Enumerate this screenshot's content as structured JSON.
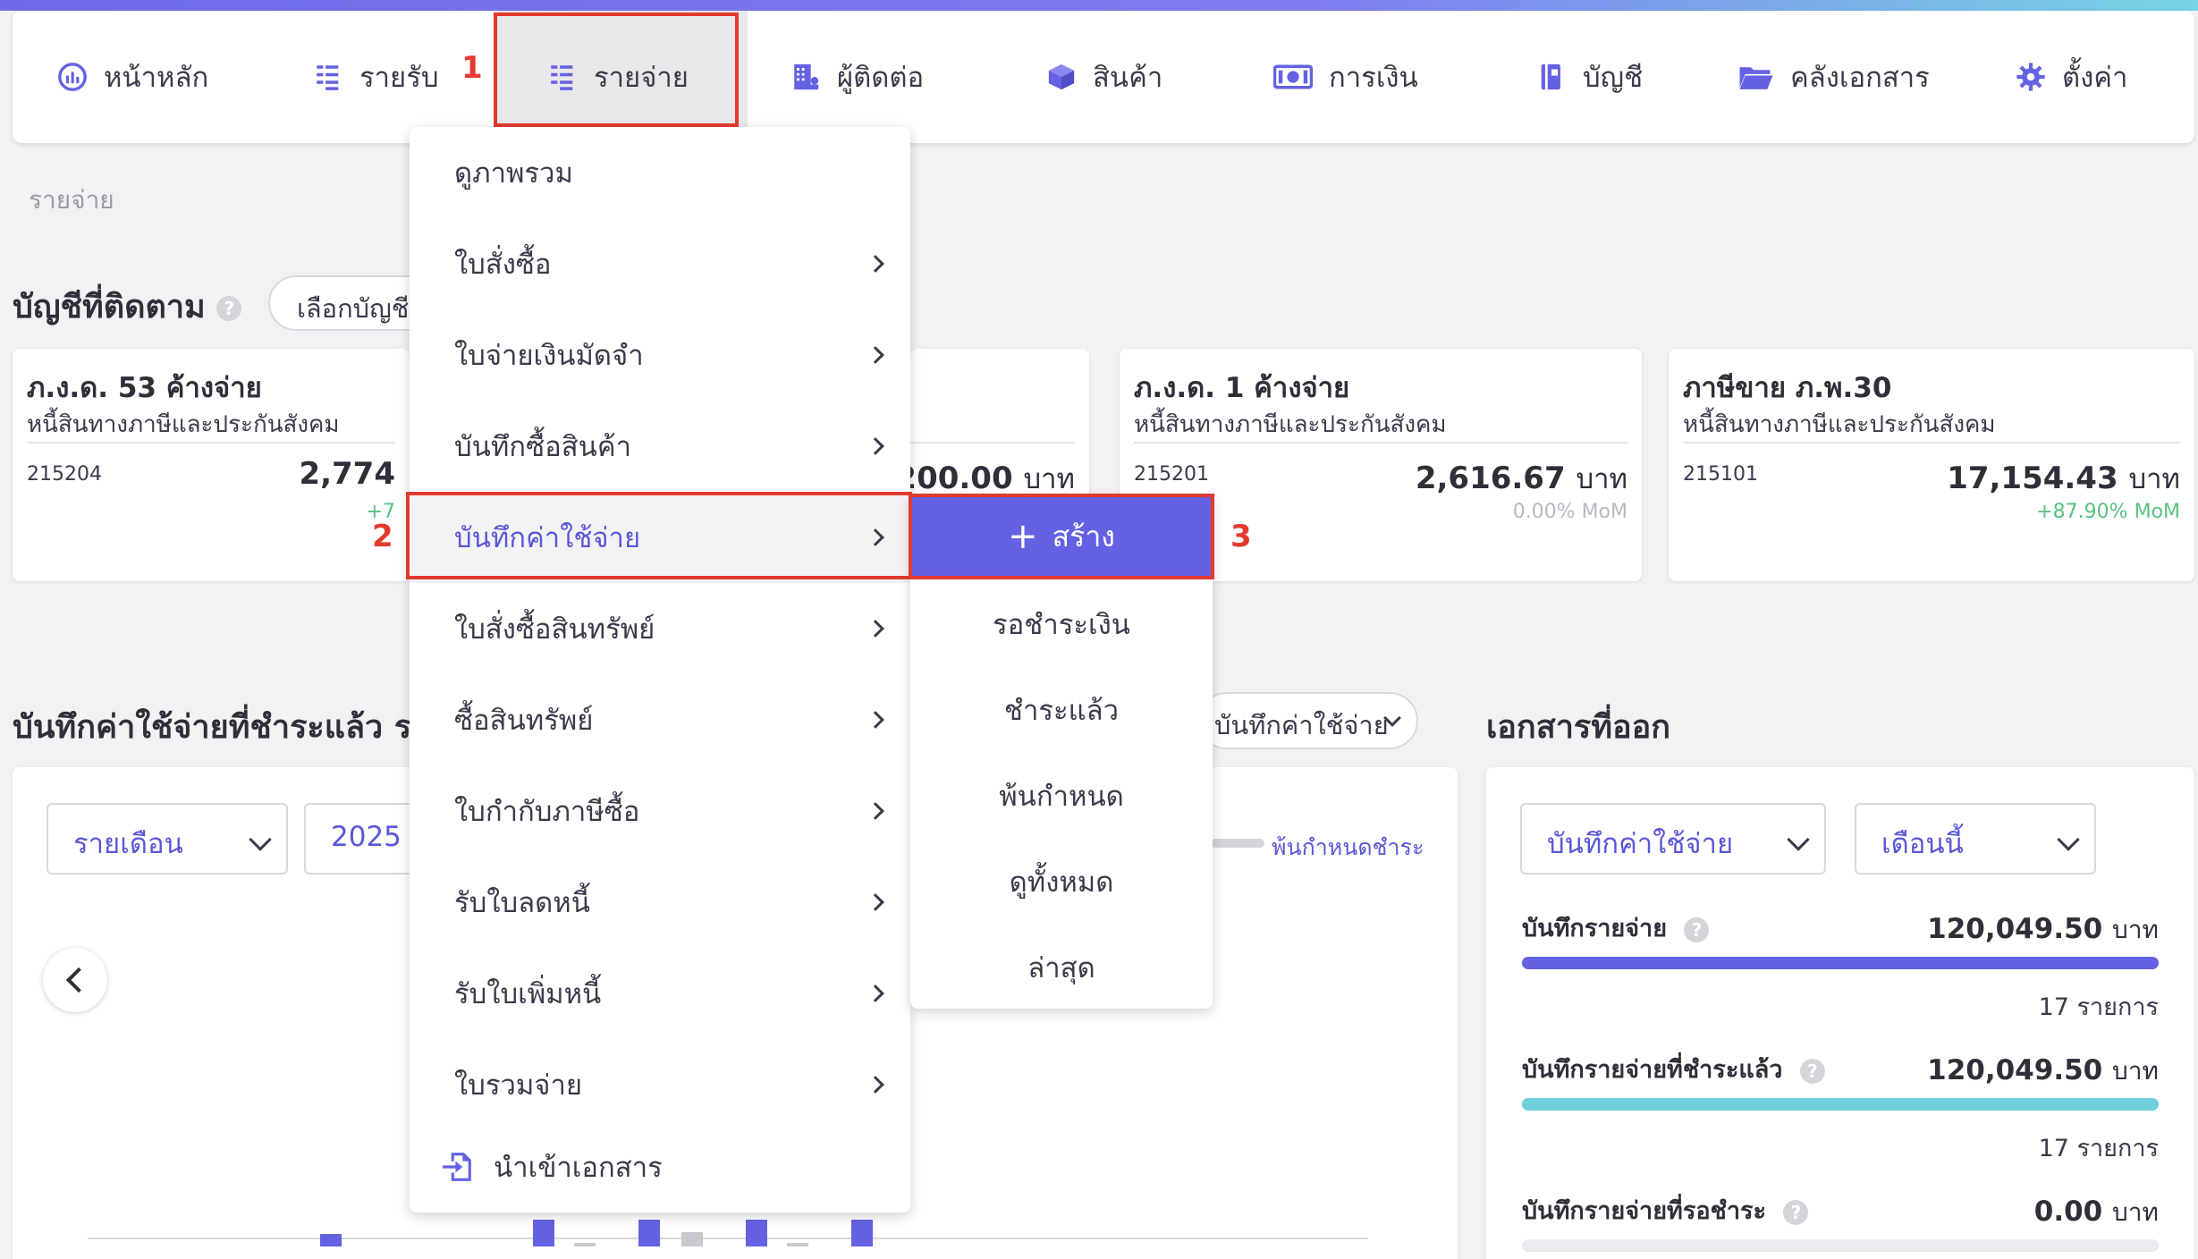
{
  "nav": {
    "items": [
      {
        "label": "หน้าหลัก",
        "icon": "dashboard-gauge-icon"
      },
      {
        "label": "รายรับ",
        "icon": "income-list-icon"
      },
      {
        "label": "รายจ่าย",
        "icon": "expense-list-icon"
      },
      {
        "label": "ผู้ติดต่อ",
        "icon": "contacts-building-icon"
      },
      {
        "label": "สินค้า",
        "icon": "product-box-icon"
      },
      {
        "label": "การเงิน",
        "icon": "money-bill-icon"
      },
      {
        "label": "บัญชี",
        "icon": "ledger-book-icon"
      },
      {
        "label": "คลังเอกสาร",
        "icon": "folder-icon"
      },
      {
        "label": "ตั้งค่า",
        "icon": "gear-icon"
      }
    ],
    "active": "รายจ่าย"
  },
  "annotations": {
    "step1": "1",
    "step2": "2",
    "step3": "3",
    "color": "#e23a2e"
  },
  "breadcrumb": "รายจ่าย",
  "watched_accounts": {
    "title": "บัญชีที่ติดตาม",
    "select_button": "เลือกบัญชี",
    "cards": [
      {
        "title": "ภ.ง.ด. 53 ค้างจ่าย",
        "subtitle": "หนี้สินทางภาษีและประกันสังคม",
        "code": "215204",
        "amount": "2,774",
        "unit": "",
        "mom": "+7"
      },
      {
        "title": "",
        "subtitle": "",
        "code": "",
        "amount": "200.00",
        "unit": "บาท",
        "mom": ""
      },
      {
        "title": "ภ.ง.ด. 1 ค้างจ่าย",
        "subtitle": "หนี้สินทางภาษีและประกันสังคม",
        "code": "215201",
        "amount": "2,616.67",
        "unit": "บาท",
        "mom": "0.00% MoM"
      },
      {
        "title": "ภาษีขาย ภ.พ.30",
        "subtitle": "หนี้สินทางภาษีและประกันสังคม",
        "code": "215101",
        "amount": "17,154.43",
        "unit": "บาท",
        "mom": "+87.90% MoM"
      }
    ]
  },
  "chart_section": {
    "title": "บันทึกค่าใช้จ่ายที่ชำระแล้ว รอชำ",
    "filter_select": "บันทึกค่าใช้จ่าย",
    "period_select": "รายเดือน",
    "year_select": "2025",
    "legend_overdue": "พ้นกำหนดชำระ",
    "colors": {
      "primary": "#6462e2",
      "grey": "#c8c8d0"
    }
  },
  "menu": {
    "items": [
      {
        "label": "ดูภาพรวม",
        "submenu": false
      },
      {
        "label": "ใบสั่งซื้อ",
        "submenu": true
      },
      {
        "label": "ใบจ่ายเงินมัดจำ",
        "submenu": true
      },
      {
        "label": "บันทึกซื้อสินค้า",
        "submenu": true
      },
      {
        "label": "บันทึกค่าใช้จ่าย",
        "submenu": true
      },
      {
        "label": "ใบสั่งซื้อสินทรัพย์",
        "submenu": true
      },
      {
        "label": "ซื้อสินทรัพย์",
        "submenu": true
      },
      {
        "label": "ใบกำกับภาษีซื้อ",
        "submenu": true
      },
      {
        "label": "รับใบลดหนี้",
        "submenu": true
      },
      {
        "label": "รับใบเพิ่มหนี้",
        "submenu": true
      },
      {
        "label": "ใบรวมจ่าย",
        "submenu": true
      }
    ],
    "import_label": "นำเข้าเอกสาร",
    "import_icon": "import-file-icon"
  },
  "submenu": {
    "create_label": "สร้าง",
    "items": [
      "รอชำระเงิน",
      "ชำระแล้ว",
      "พ้นกำหนด",
      "ดูทั้งหมด",
      "ล่าสุด"
    ]
  },
  "documents": {
    "title": "เอกสารที่ออก",
    "doc_select": "บันทึกค่าใช้จ่าย",
    "month_select": "เดือนนี้",
    "stats": [
      {
        "label": "บันทึกรายจ่าย",
        "value": "120,049.50",
        "unit": "บาท",
        "count": "17 รายการ",
        "fill": 1.0,
        "color": "#6462e2"
      },
      {
        "label": "บันทึกรายจ่ายที่ชำระแล้ว",
        "value": "120,049.50",
        "unit": "บาท",
        "count": "17 รายการ",
        "fill": 1.0,
        "color": "#6fd0dc"
      },
      {
        "label": "บันทึกรายจ่ายที่รอชำระ",
        "value": "0.00",
        "unit": "บาท",
        "count": "",
        "fill": 0.0,
        "color": "#ebebef"
      }
    ]
  }
}
